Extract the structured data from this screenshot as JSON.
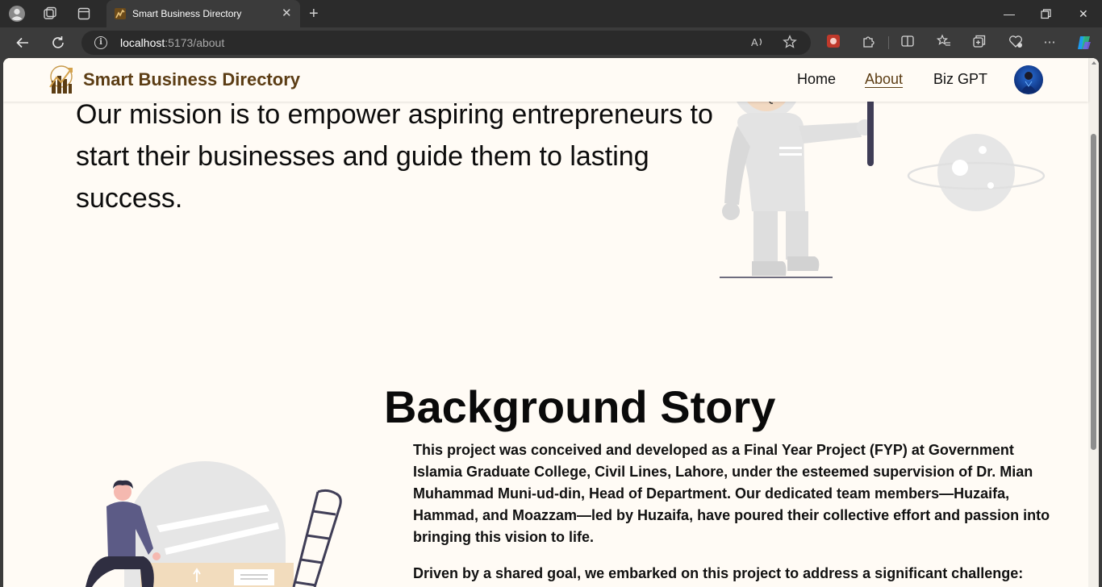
{
  "browser": {
    "tab_title": "Smart Business Directory",
    "url_host": "localhost",
    "url_rest": ":5173/about"
  },
  "site": {
    "brand": "Smart Business Directory",
    "nav": {
      "home": "Home",
      "about": "About",
      "bizgpt": "Biz GPT"
    },
    "active_nav": "About"
  },
  "page": {
    "mission": "Our mission is to empower aspiring entrepreneurs to start their businesses and guide them to lasting success.",
    "story_title": "Background Story",
    "story_p1": "This project was conceived and developed as a Final Year Project (FYP) at Government Islamia Graduate College, Civil Lines, Lahore, under the esteemed supervision of Dr. Mian Muhammad Muni-ud-din, Head of Department. Our dedicated team members—Huzaifa, Hammad, and Moazzam—led by Huzaifa, have poured their collective effort and passion into bringing this vision to life.",
    "story_p2": "Driven by a shared goal, we embarked on this project to address a significant challenge: enabling"
  },
  "colors": {
    "page_bg": "#fffbf5",
    "brand": "#5c3d14",
    "chrome_dark": "#2b2b2b",
    "chrome_toolbar": "#3b3b3b"
  },
  "icons": {
    "profile": "profile-icon",
    "workspaces": "workspaces-icon",
    "tab_actions": "tab-actions-icon",
    "back": "back-arrow-icon",
    "refresh": "refresh-icon",
    "read_aloud": "read-aloud-icon",
    "favorite": "star-icon",
    "extensions": "puzzle-icon",
    "copilot": "copilot-icon"
  }
}
